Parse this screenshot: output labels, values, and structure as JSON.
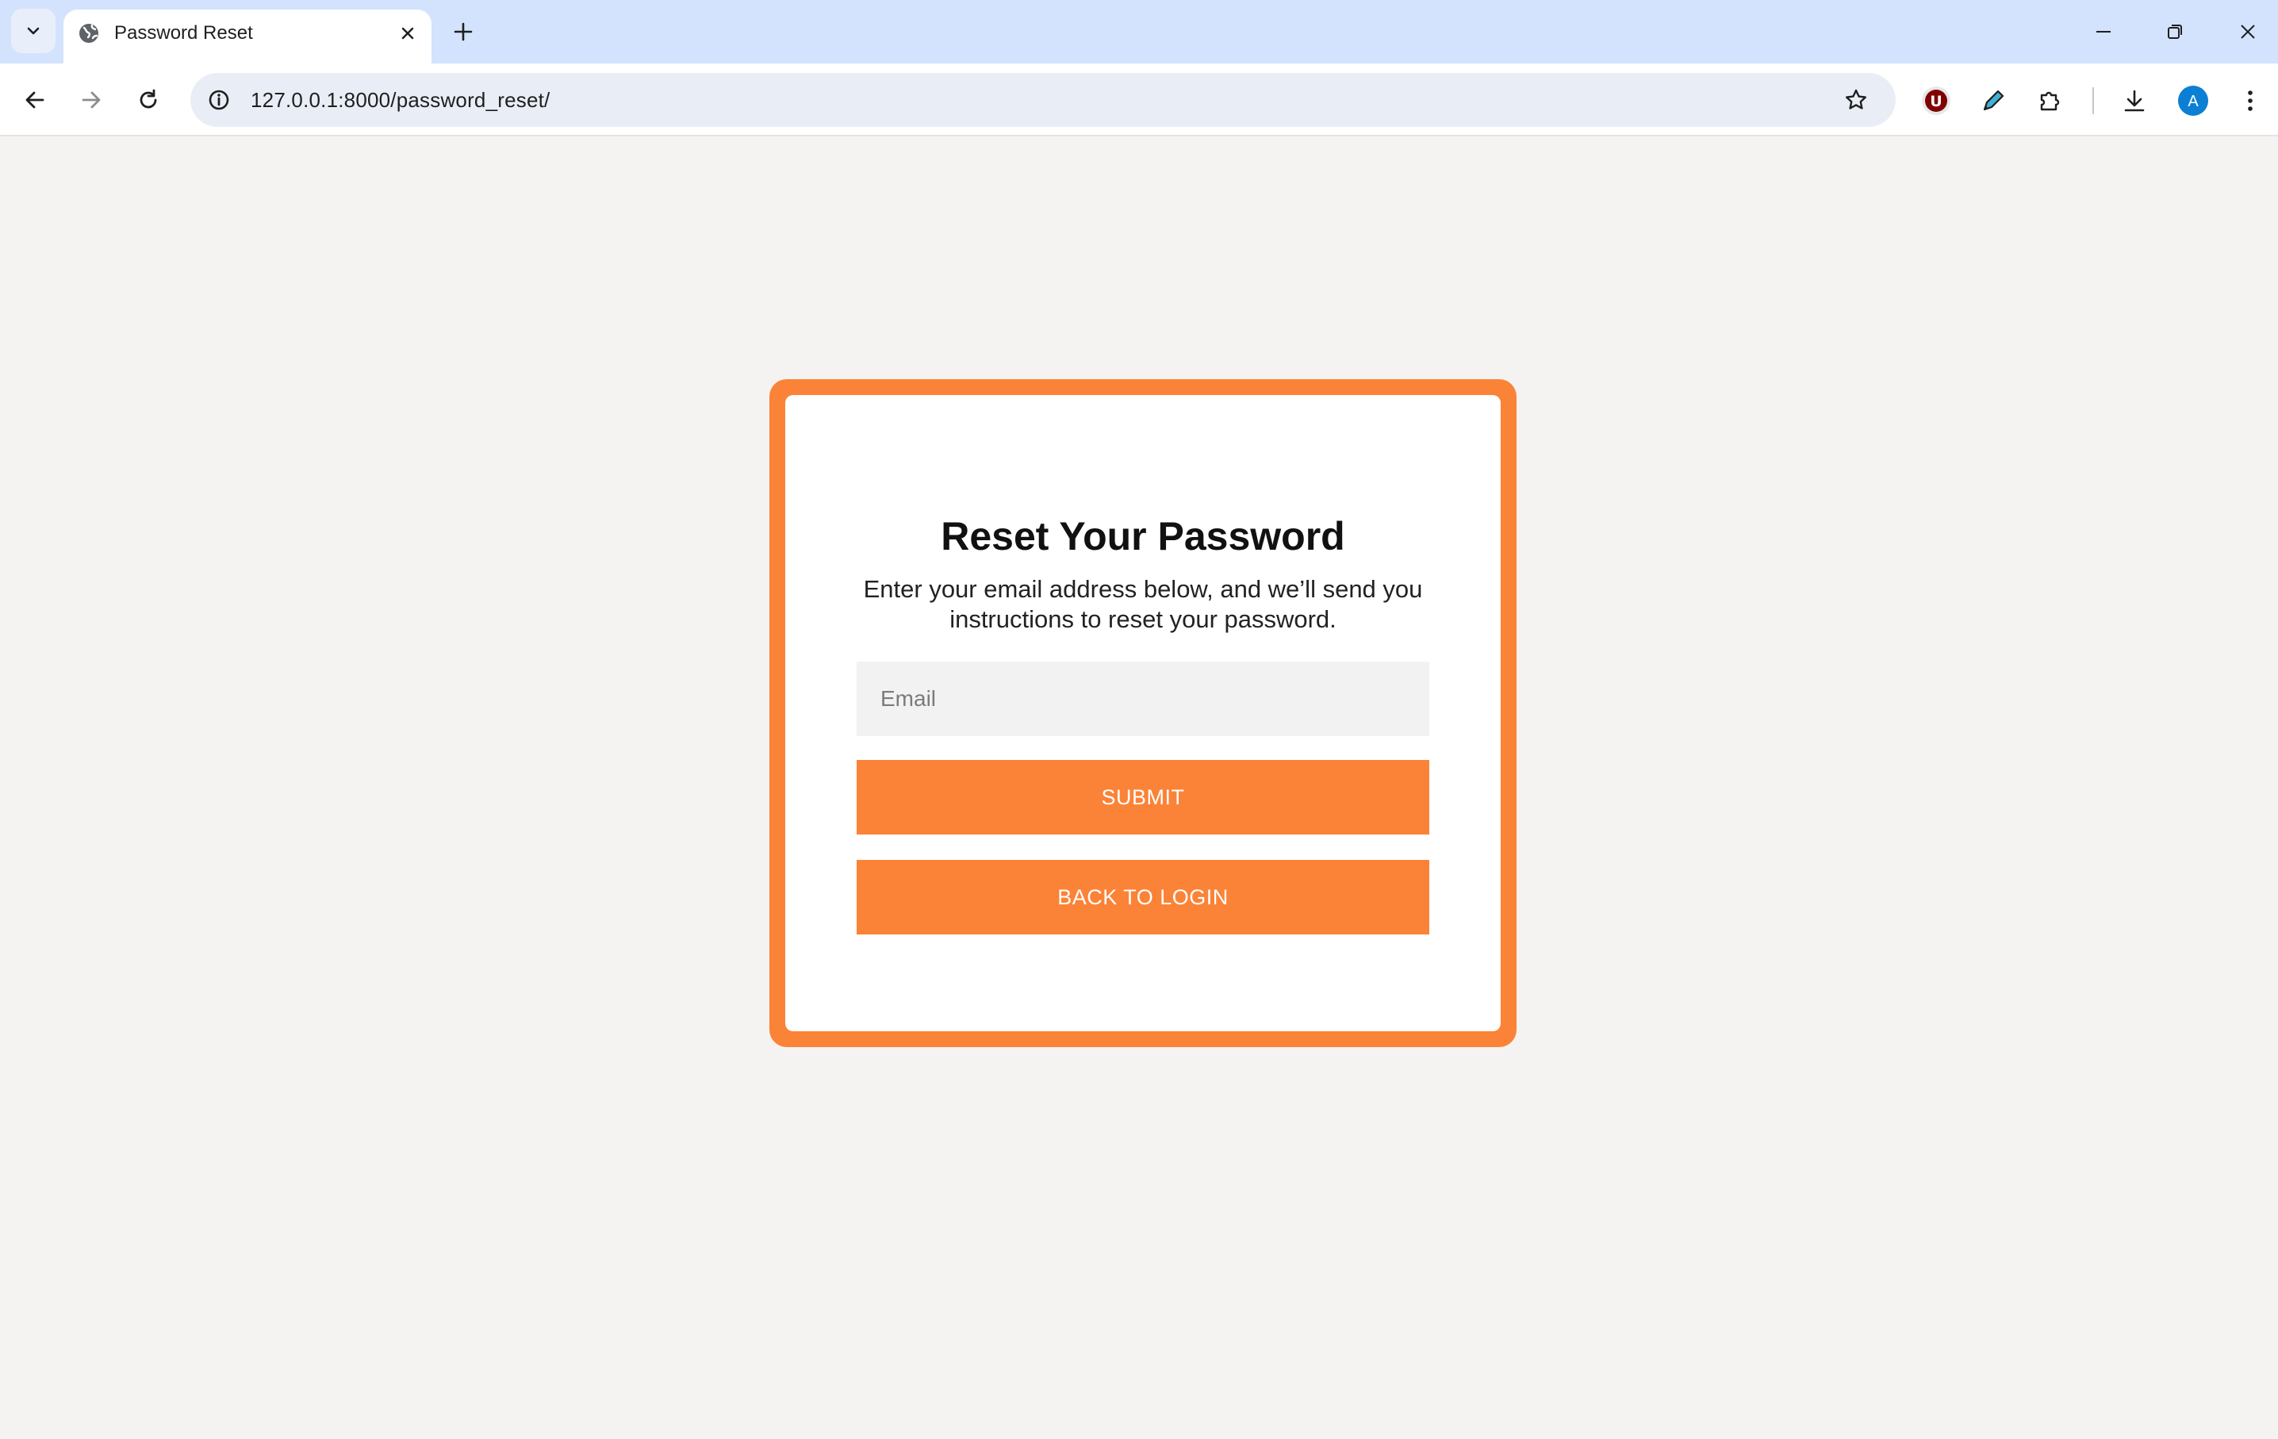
{
  "browser": {
    "tab_title": "Password Reset",
    "url": "127.0.0.1:8000/password_reset/",
    "profile_initial": "A",
    "extension_badge": "U"
  },
  "page": {
    "title": "Reset Your Password",
    "description": "Enter your email address below, and we’ll send you instructions to reset your password.",
    "email_placeholder": "Email",
    "submit_label": "SUBMIT",
    "back_label": "BACK TO LOGIN"
  },
  "colors": {
    "accent": "#fb8337",
    "page_background": "#f4f3f1",
    "tabstrip": "#d3e3fd"
  }
}
